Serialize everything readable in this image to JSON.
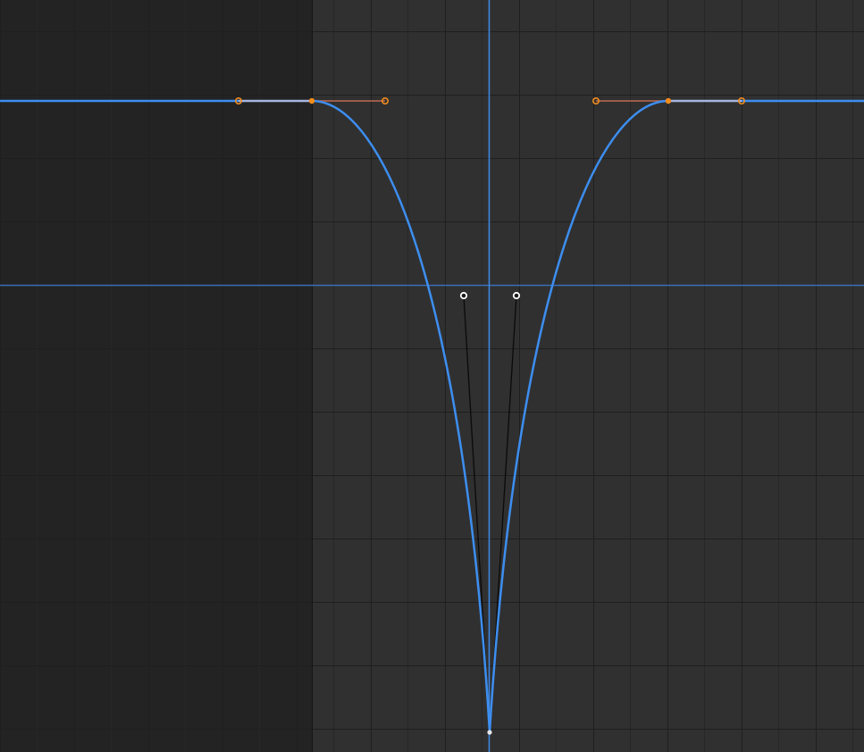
{
  "editor": {
    "name": "graph-editor",
    "colors": {
      "out_of_range_background": "#232323",
      "in_range_background": "#303030",
      "grid_line_minor": "#272727",
      "grid_line_major": "#1f1f1f",
      "frame_start_line": "#151515",
      "playhead_line": "#3e8ae6",
      "cursor_value_line": "#3a6eb8",
      "curve": "#3d8ef0",
      "curve_highlight": "#a7b6e2",
      "selected_key": "#f08c1e",
      "selected_handle_line": "#c06a52",
      "active_handle": "#ffffff",
      "active_handle_line": "#0a0a0a",
      "active_key": "#e6e6e6"
    },
    "curve_shape": "dip",
    "keyframes": [
      {
        "name": "keyframe-left-plateau",
        "selected": true,
        "interpolation": "bezier"
      },
      {
        "name": "keyframe-bottom",
        "selected": false,
        "active": true,
        "interpolation": "bezier"
      },
      {
        "name": "keyframe-right-plateau",
        "selected": true,
        "interpolation": "bezier"
      }
    ]
  }
}
